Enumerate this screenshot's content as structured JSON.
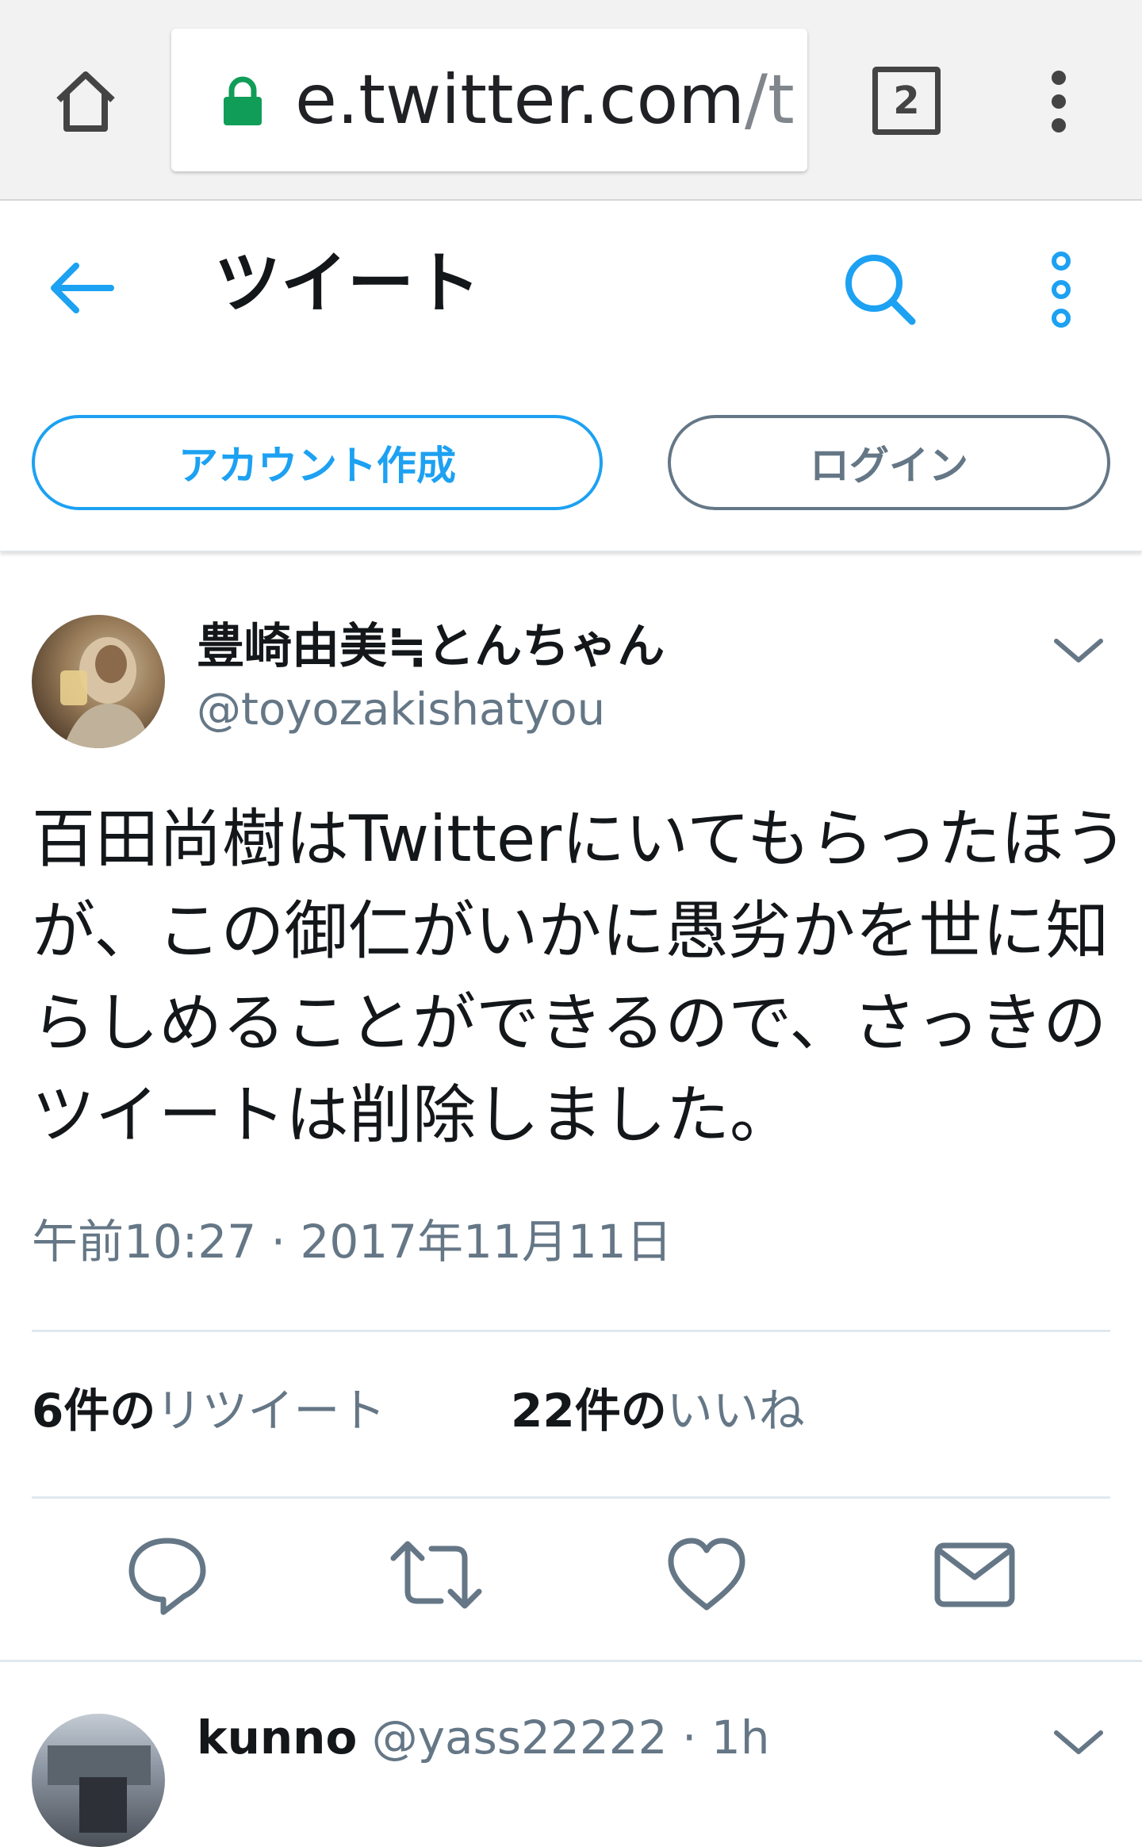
{
  "browser": {
    "url_main": "e.twitter.com",
    "url_rest": "/t",
    "tab_count": "2"
  },
  "header": {
    "title": "ツイート",
    "signup_label": "アカウント作成",
    "login_label": "ログイン"
  },
  "tweet": {
    "display_name": "豊崎由美≒とんちゃん",
    "handle": "@toyozakishatyou",
    "text_lines": [
      "百田尚樹はTwitterにいてもらったほう",
      "が、この御仁がいかに愚劣かを世に知",
      "らしめることができるので、さっきの",
      "ツイートは削除しました。"
    ],
    "timestamp": "午前10:27 · 2017年11月11日",
    "retweets": {
      "count": "6件の",
      "label": "リツイート"
    },
    "likes": {
      "count": "22件の",
      "label": "いいね"
    }
  },
  "actions": [
    "reply-icon",
    "retweet-icon",
    "like-icon",
    "direct-message-icon"
  ],
  "reply": {
    "name": "kunno",
    "meta": "@yass22222 · 1h"
  },
  "colors": {
    "accent": "#1da1f2",
    "secondary_text": "#657786",
    "primary_text": "#14171a",
    "lock": "#0f9d58"
  }
}
